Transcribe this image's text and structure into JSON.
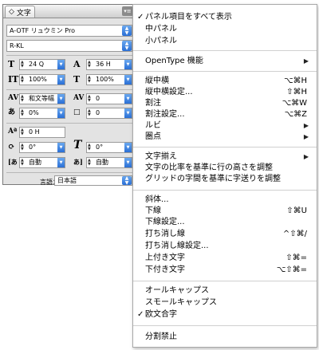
{
  "panel": {
    "tab_label": "文字",
    "tab_arrows": "◇",
    "menu_btn": "▾≡",
    "font_family": "A-OTF リュウミン Pro",
    "font_style": "R-KL",
    "font_size": "24 Q",
    "leading": "36 H",
    "vertical_scale": "100%",
    "horizontal_scale": "100%",
    "kerning": "和文等幅",
    "tracking": "0",
    "tsume": "0%",
    "aki": "0",
    "baseline_shift": "0 H",
    "char_rotation": "0°",
    "skew": "0°",
    "aki_before": "自動",
    "aki_after": "自動",
    "language_label": "言語：",
    "language_value": "日本語"
  },
  "menu": {
    "items": [
      {
        "check": "✓",
        "label": "パネル項目をすべて表示",
        "shortcut": "",
        "arrow": ""
      },
      {
        "check": "",
        "label": "中パネル",
        "shortcut": "",
        "arrow": ""
      },
      {
        "check": "",
        "label": "小パネル",
        "shortcut": "",
        "arrow": ""
      },
      {
        "check": "",
        "label": "OpenType 機能",
        "shortcut": "",
        "arrow": "▶"
      },
      {
        "check": "",
        "label": "縦中横",
        "shortcut": "⌥⌘H",
        "arrow": ""
      },
      {
        "check": "",
        "label": "縦中横設定...",
        "shortcut": "⇧⌘H",
        "arrow": ""
      },
      {
        "check": "",
        "label": "割注",
        "shortcut": "⌥⌘W",
        "arrow": ""
      },
      {
        "check": "",
        "label": "割注設定...",
        "shortcut": "⌥⌘Z",
        "arrow": ""
      },
      {
        "check": "",
        "label": "ルビ",
        "shortcut": "",
        "arrow": "▶"
      },
      {
        "check": "",
        "label": "圏点",
        "shortcut": "",
        "arrow": "▶"
      },
      {
        "check": "",
        "label": "文字揃え",
        "shortcut": "",
        "arrow": "▶"
      },
      {
        "check": "",
        "label": "文字の比率を基準に行の高さを調整",
        "shortcut": "",
        "arrow": ""
      },
      {
        "check": "",
        "label": "グリッドの字間を基準に字送りを調整",
        "shortcut": "",
        "arrow": ""
      },
      {
        "check": "",
        "label": "斜体...",
        "shortcut": "",
        "arrow": ""
      },
      {
        "check": "",
        "label": "下線",
        "shortcut": "⇧⌘U",
        "arrow": ""
      },
      {
        "check": "",
        "label": "下線設定...",
        "shortcut": "",
        "arrow": ""
      },
      {
        "check": "",
        "label": "打ち消し線",
        "shortcut": "^⇧⌘/",
        "arrow": ""
      },
      {
        "check": "",
        "label": "打ち消し線設定...",
        "shortcut": "",
        "arrow": ""
      },
      {
        "check": "",
        "label": "上付き文字",
        "shortcut": "⇧⌘=",
        "arrow": ""
      },
      {
        "check": "",
        "label": "下付き文字",
        "shortcut": "⌥⇧⌘=",
        "arrow": ""
      },
      {
        "check": "",
        "label": "オールキャップス",
        "shortcut": "",
        "arrow": ""
      },
      {
        "check": "",
        "label": "スモールキャップス",
        "shortcut": "",
        "arrow": ""
      },
      {
        "check": "✓",
        "label": "欧文合字",
        "shortcut": "",
        "arrow": ""
      },
      {
        "check": "",
        "label": "分割禁止",
        "shortcut": "",
        "arrow": ""
      }
    ]
  }
}
